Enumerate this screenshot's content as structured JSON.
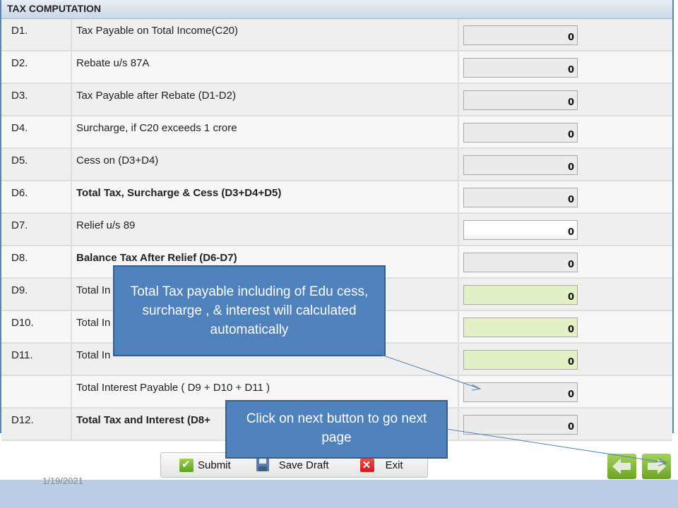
{
  "panel": {
    "title": "TAX COMPUTATION",
    "rows": [
      {
        "code": "D1.",
        "desc": "Tax Payable on Total Income(C20)",
        "value": "0",
        "bold": false,
        "field_state": "readonly"
      },
      {
        "code": "D2.",
        "desc": "Rebate u/s 87A",
        "value": "0",
        "bold": false,
        "field_state": "readonly"
      },
      {
        "code": "D3.",
        "desc": "Tax Payable after Rebate (D1-D2)",
        "value": "0",
        "bold": false,
        "field_state": "readonly"
      },
      {
        "code": "D4.",
        "desc": "Surcharge, if C20 exceeds 1 crore",
        "value": "0",
        "bold": false,
        "field_state": "readonly"
      },
      {
        "code": "D5.",
        "desc": "Cess on (D3+D4)",
        "value": "0",
        "bold": false,
        "field_state": "readonly"
      },
      {
        "code": "D6.",
        "desc": "Total Tax, Surcharge & Cess (D3+D4+D5)",
        "value": "0",
        "bold": true,
        "field_state": "readonly"
      },
      {
        "code": "D7.",
        "desc": "Relief u/s 89",
        "value": "0",
        "bold": false,
        "field_state": "editable"
      },
      {
        "code": "D8.",
        "desc": "Balance Tax After Relief (D6-D7)",
        "value": "0",
        "bold": true,
        "field_state": "readonly"
      },
      {
        "code": "D9.",
        "desc": "Total In",
        "value": "0",
        "bold": false,
        "field_state": "highlighted"
      },
      {
        "code": "D10.",
        "desc": "Total In",
        "value": "0",
        "bold": false,
        "field_state": "highlighted"
      },
      {
        "code": "D11.",
        "desc": "Total In",
        "value": "0",
        "bold": false,
        "field_state": "highlighted"
      },
      {
        "code": "",
        "desc": "Total Interest Payable ( D9 + D10 + D11 )",
        "value": "0",
        "bold": false,
        "field_state": "readonly"
      },
      {
        "code": "D12.",
        "desc": "Total Tax and Interest (D8+",
        "value": "0",
        "bold": true,
        "field_state": "readonly"
      }
    ]
  },
  "actions": {
    "submit": "Submit",
    "save_draft": "Save Draft",
    "exit": "Exit"
  },
  "nav": {
    "prev_icon": "arrow-left-icon",
    "next_icon": "arrow-right-icon"
  },
  "callouts": {
    "tax_note": "Total Tax payable including of Edu cess, surcharge , & interest  will calculated automatically",
    "next_note": "Click on next button to go next page"
  },
  "footer": {
    "date": "1/19/2021"
  },
  "colors": {
    "callout_fill": "#4f81bd",
    "callout_border": "#385d8a",
    "highlight_field": "#e2f0c6",
    "nav_green": "#7db33a",
    "footer_band": "#b9cde4"
  }
}
